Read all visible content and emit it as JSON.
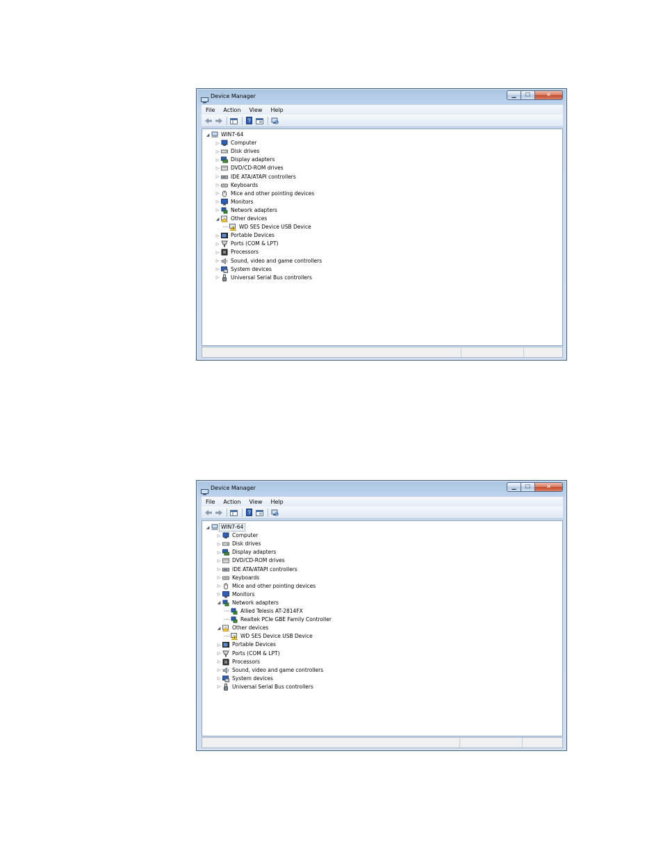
{
  "colors": {
    "selection_border": "#7a8fa8",
    "warning_yellow": "#f4c430",
    "link_blue": "#2f5fb5"
  },
  "window1": {
    "title": "Device Manager",
    "menu": [
      "File",
      "Action",
      "View",
      "Help"
    ],
    "caption_buttons": {
      "minimize": "▁",
      "maximize": "☐",
      "close": "✕"
    },
    "tree": {
      "root": "WIN7-64",
      "items": [
        {
          "label": "Computer",
          "icon": "computer-icon",
          "expanded": false
        },
        {
          "label": "Disk drives",
          "icon": "disk-drive-icon",
          "expanded": false
        },
        {
          "label": "Display adapters",
          "icon": "display-adapter-icon",
          "expanded": false
        },
        {
          "label": "DVD/CD-ROM drives",
          "icon": "dvd-drive-icon",
          "expanded": false
        },
        {
          "label": "IDE ATA/ATAPI controllers",
          "icon": "ide-controller-icon",
          "expanded": false
        },
        {
          "label": "Keyboards",
          "icon": "keyboard-icon",
          "expanded": false
        },
        {
          "label": "Mice and other pointing devices",
          "icon": "mouse-icon",
          "expanded": false
        },
        {
          "label": "Monitors",
          "icon": "monitor-icon",
          "expanded": false
        },
        {
          "label": "Network adapters",
          "icon": "network-adapter-icon",
          "expanded": false
        },
        {
          "label": "Other devices",
          "icon": "other-devices-icon",
          "expanded": true,
          "children": [
            {
              "label": "WD SES Device USB Device",
              "icon": "warning-device-icon"
            }
          ]
        },
        {
          "label": "Portable Devices",
          "icon": "portable-device-icon",
          "expanded": false
        },
        {
          "label": "Ports (COM & LPT)",
          "icon": "port-icon",
          "expanded": false
        },
        {
          "label": "Processors",
          "icon": "processor-icon",
          "expanded": false
        },
        {
          "label": "Sound, video and game controllers",
          "icon": "sound-icon",
          "expanded": false
        },
        {
          "label": "System devices",
          "icon": "system-device-icon",
          "expanded": false
        },
        {
          "label": "Universal Serial Bus controllers",
          "icon": "usb-icon",
          "expanded": false
        }
      ]
    }
  },
  "window2": {
    "title": "Device Manager",
    "menu": [
      "File",
      "Action",
      "View",
      "Help"
    ],
    "caption_buttons": {
      "minimize": "▁",
      "maximize": "☐",
      "close": "✕"
    },
    "tree": {
      "root": "WIN7-64",
      "items": [
        {
          "label": "Computer",
          "icon": "computer-icon",
          "expanded": false
        },
        {
          "label": "Disk drives",
          "icon": "disk-drive-icon",
          "expanded": false
        },
        {
          "label": "Display adapters",
          "icon": "display-adapter-icon",
          "expanded": false
        },
        {
          "label": "DVD/CD-ROM drives",
          "icon": "dvd-drive-icon",
          "expanded": false
        },
        {
          "label": "IDE ATA/ATAPI controllers",
          "icon": "ide-controller-icon",
          "expanded": false
        },
        {
          "label": "Keyboards",
          "icon": "keyboard-icon",
          "expanded": false
        },
        {
          "label": "Mice and other pointing devices",
          "icon": "mouse-icon",
          "expanded": false
        },
        {
          "label": "Monitors",
          "icon": "monitor-icon",
          "expanded": false
        },
        {
          "label": "Network adapters",
          "icon": "network-adapter-icon",
          "expanded": true,
          "children": [
            {
              "label": "Allied Telesis AT-2814FX",
              "icon": "network-adapter-icon"
            },
            {
              "label": "Realtek PCIe GBE Family Controller",
              "icon": "network-adapter-icon"
            }
          ]
        },
        {
          "label": "Other devices",
          "icon": "other-devices-icon",
          "expanded": true,
          "children": [
            {
              "label": "WD SES Device USB Device",
              "icon": "warning-device-icon"
            }
          ]
        },
        {
          "label": "Portable Devices",
          "icon": "portable-device-icon",
          "expanded": false
        },
        {
          "label": "Ports (COM & LPT)",
          "icon": "port-icon",
          "expanded": false
        },
        {
          "label": "Processors",
          "icon": "processor-icon",
          "expanded": false
        },
        {
          "label": "Sound, video and game controllers",
          "icon": "sound-icon",
          "expanded": false
        },
        {
          "label": "System devices",
          "icon": "system-device-icon",
          "expanded": false
        },
        {
          "label": "Universal Serial Bus controllers",
          "icon": "usb-icon",
          "expanded": false
        }
      ]
    }
  }
}
